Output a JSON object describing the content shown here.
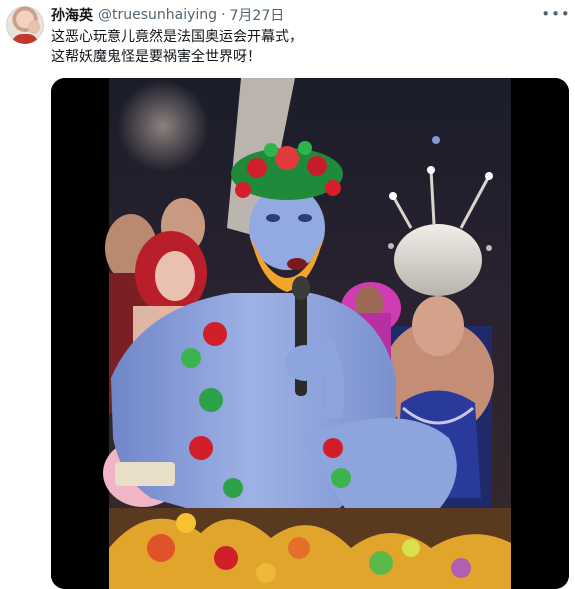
{
  "tweet": {
    "display_name": "孙海英",
    "handle": "@truesunhaiying",
    "separator": "·",
    "timestamp": "7月27日",
    "more_icon": "more-horizontal-icon",
    "text_lines": [
      "这恶心玩意儿竟然是法国奥运会开幕式，",
      "这帮妖魔鬼怪是要祸害全世界呀！"
    ],
    "media": {
      "type": "video"
    }
  },
  "colors": {
    "text_primary": "#0f1419",
    "text_secondary": "#536471",
    "background": "#ffffff",
    "media_border": "#000000"
  }
}
